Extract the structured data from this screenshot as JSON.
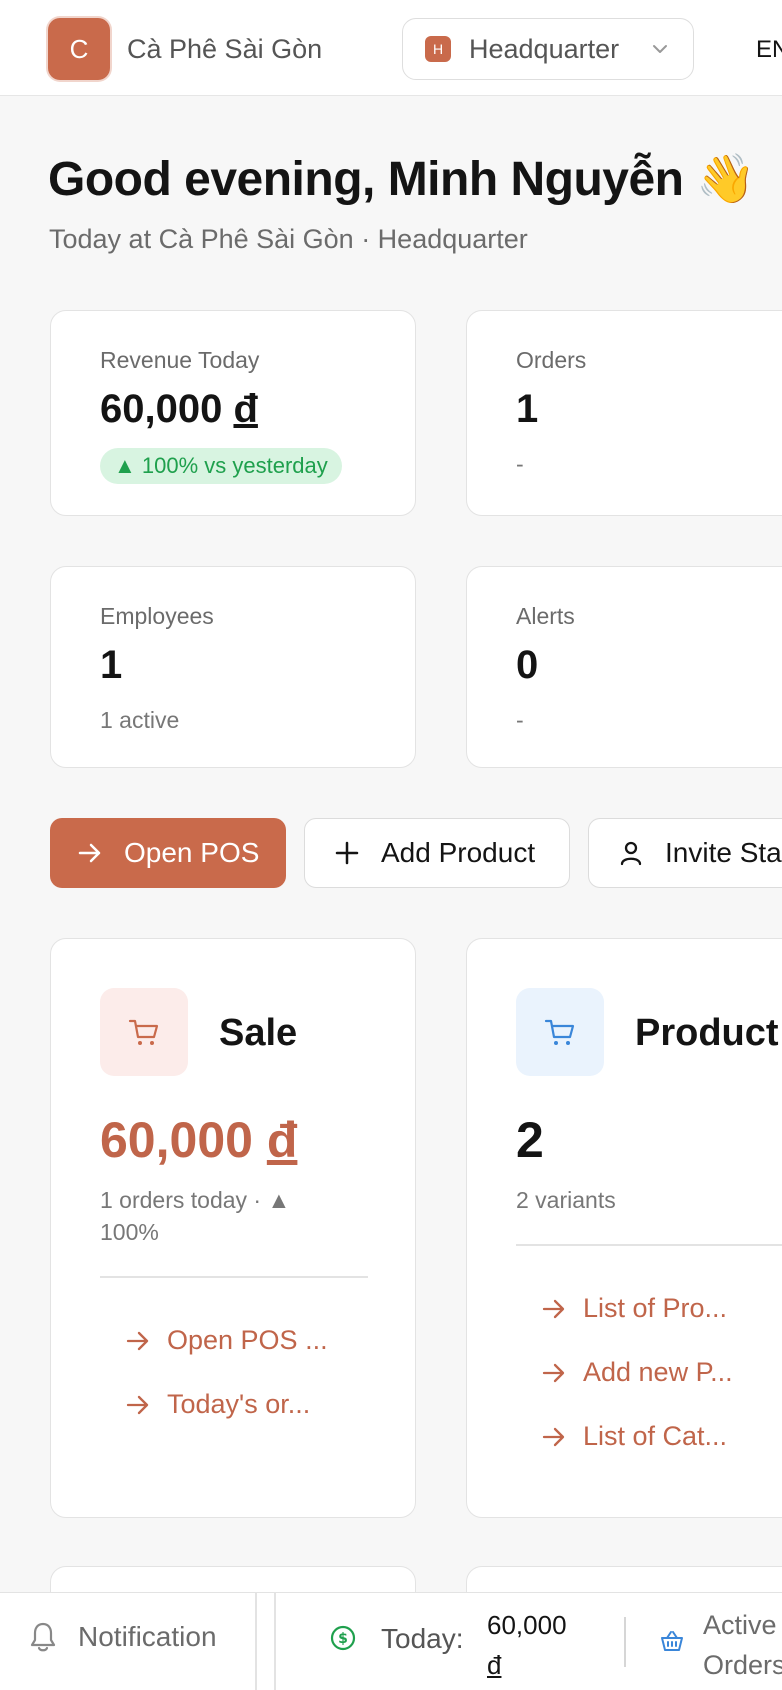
{
  "header": {
    "brand_initial": "C",
    "brand_name": "Cà Phê Sài Gòn",
    "branch_badge": "H",
    "branch_name": "Headquarter",
    "language": "EN"
  },
  "greeting": {
    "title": "Good evening, Minh Nguyễn 👋",
    "subtitle": "Today at Cà Phê Sài Gòn · Headquarter"
  },
  "stats": {
    "revenue": {
      "label": "Revenue Today",
      "amount": "60,000",
      "currency": "đ",
      "delta": "▲ 100% vs yesterday"
    },
    "orders": {
      "label": "Orders",
      "value": "1",
      "foot": "-"
    },
    "employees": {
      "label": "Employees",
      "value": "1",
      "foot": "1 active"
    },
    "alerts": {
      "label": "Alerts",
      "value": "0",
      "foot": "-"
    }
  },
  "actions": {
    "open_pos": "Open POS",
    "add_product": "Add Product",
    "invite_staff": "Invite Sta"
  },
  "modules": {
    "sale": {
      "title": "Sale",
      "amount": "60,000",
      "currency": "đ",
      "sub_line1": "1 orders today · ▲",
      "sub_line2": "100%",
      "links": [
        "Open POS ...",
        "Today's or..."
      ]
    },
    "product": {
      "title": "Product",
      "value": "2",
      "sub": "2 variants",
      "links": [
        "List of Pro...",
        "Add new P...",
        "List of Cat..."
      ]
    }
  },
  "bottombar": {
    "notification": "Notification",
    "today_label": "Today:",
    "today_amount": "60,000",
    "today_currency": "đ",
    "active_line1": "Active",
    "active_line2": "Orders"
  },
  "colors": {
    "accent": "#c96a4b",
    "success": "#1fa04d",
    "info": "#3a86d9"
  }
}
